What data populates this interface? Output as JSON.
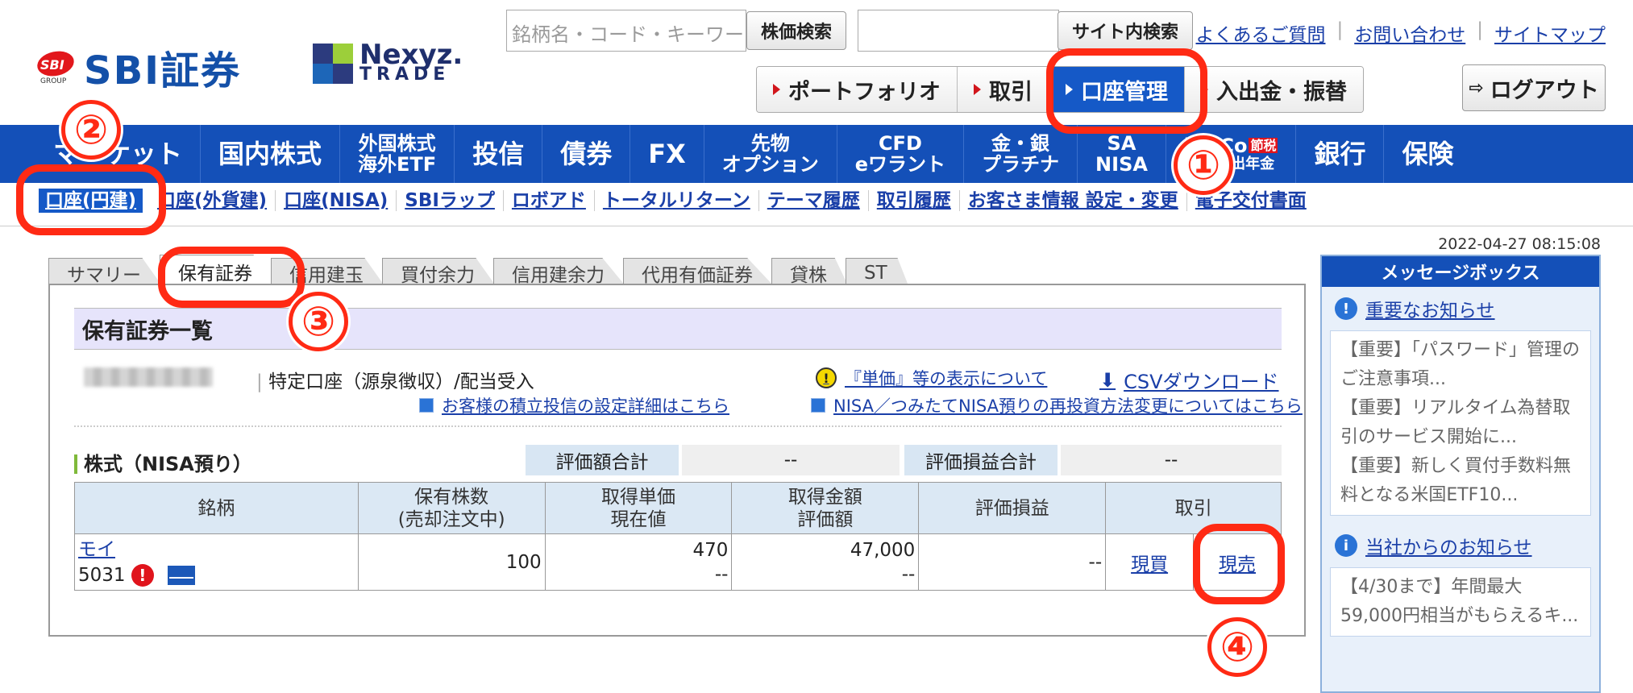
{
  "header": {
    "brand_sbi": "SBI証券",
    "brand_sbi_mark": "SBI",
    "brand_sbi_group": "GROUP",
    "brand_nexyz_1": "Nexyz.",
    "brand_nexyz_2": "TRADE",
    "stock_search_placeholder": "銘柄名・コード・キーワード",
    "stock_search_button": "株価検索",
    "site_search_button": "サイト内検索",
    "links": [
      "よくあるご質問",
      "お問い合わせ",
      "サイトマップ"
    ],
    "segments": [
      "ポートフォリオ",
      "取引",
      "口座管理",
      "入出金・振替"
    ],
    "logout": "ログアウト"
  },
  "mainnav": {
    "items": [
      {
        "label": "マーケット"
      },
      {
        "label": "国内株式"
      },
      {
        "label": "外国株式",
        "sub": "海外ETF"
      },
      {
        "label": "投信"
      },
      {
        "label": "債券"
      },
      {
        "label": "FX"
      },
      {
        "label": "先物",
        "sub": "オプション"
      },
      {
        "label": "CFD",
        "sub": "eワラント"
      },
      {
        "label": "金・銀",
        "sub": "プラチナ"
      },
      {
        "label": "SA",
        "sub": "NISA"
      },
      {
        "label": "iDeCo",
        "sub": "確定拠出年金",
        "badge": "節税"
      },
      {
        "label": "銀行"
      },
      {
        "label": "保険"
      }
    ]
  },
  "subnav": {
    "items": [
      "口座(円建)",
      "口座(外貨建)",
      "口座(NISA)",
      "SBIラップ",
      "ロボアド",
      "トータルリターン",
      "テーマ履歴",
      "取引履歴",
      "お客さま情報 設定・変更",
      "電子交付書面"
    ]
  },
  "timestamp": "2022-04-27 08:15:08",
  "tabs": [
    "サマリー",
    "保有証券",
    "信用建玉",
    "買付余力",
    "信用建余力",
    "代用有価証券",
    "貸株",
    "ST"
  ],
  "panel": {
    "title": "保有証券一覧",
    "account_type": "特定口座（源泉徴収）/配当受入",
    "notice_unit": "『単価』等の表示について",
    "csv_download": "CSVダウンロード",
    "notice_tsumitate": "お客様の積立投信の設定詳細はこちら",
    "notice_nisa": "NISA／つみたてNISA預りの再投資方法変更についてはこちら",
    "section_title": "株式（NISA預り）",
    "summary": {
      "eval_total_label": "評価額合計",
      "eval_total_value": "--",
      "pl_total_label": "評価損益合計",
      "pl_total_value": "--"
    },
    "table": {
      "headers": {
        "name": "銘柄",
        "shares_1": "保有株数",
        "shares_2": "(売却注文中)",
        "unit_1": "取得単価",
        "unit_2": "現在値",
        "amount_1": "取得金額",
        "amount_2": "評価額",
        "pl": "評価損益",
        "trade": "取引"
      },
      "rows": [
        {
          "name": "モイ",
          "code": "5031",
          "shares": "100",
          "unit_cost": "470",
          "current_price": "--",
          "acq_amount": "47,000",
          "eval_amount": "--",
          "pl": "--",
          "buy": "現買",
          "sell": "現売"
        }
      ]
    }
  },
  "messagebox": {
    "title": "メッセージボックス",
    "important_title": "重要なお知らせ",
    "important_items": [
      "【重要】「パスワード」管理のご注意事項...",
      "【重要】リアルタイム為替取引のサービス開始に...",
      "【重要】新しく買付手数料無料となる米国ETF10..."
    ],
    "company_title": "当社からのお知らせ",
    "company_items": [
      "【4/30まで】年間最大59,000円相当がもらえるキ..."
    ]
  },
  "annotations": [
    "①",
    "②",
    "③",
    "④"
  ],
  "colors": {
    "nav_blue": "#1450b8",
    "highlight_red": "#ff2a14",
    "link_blue": "#1a3fa8"
  }
}
